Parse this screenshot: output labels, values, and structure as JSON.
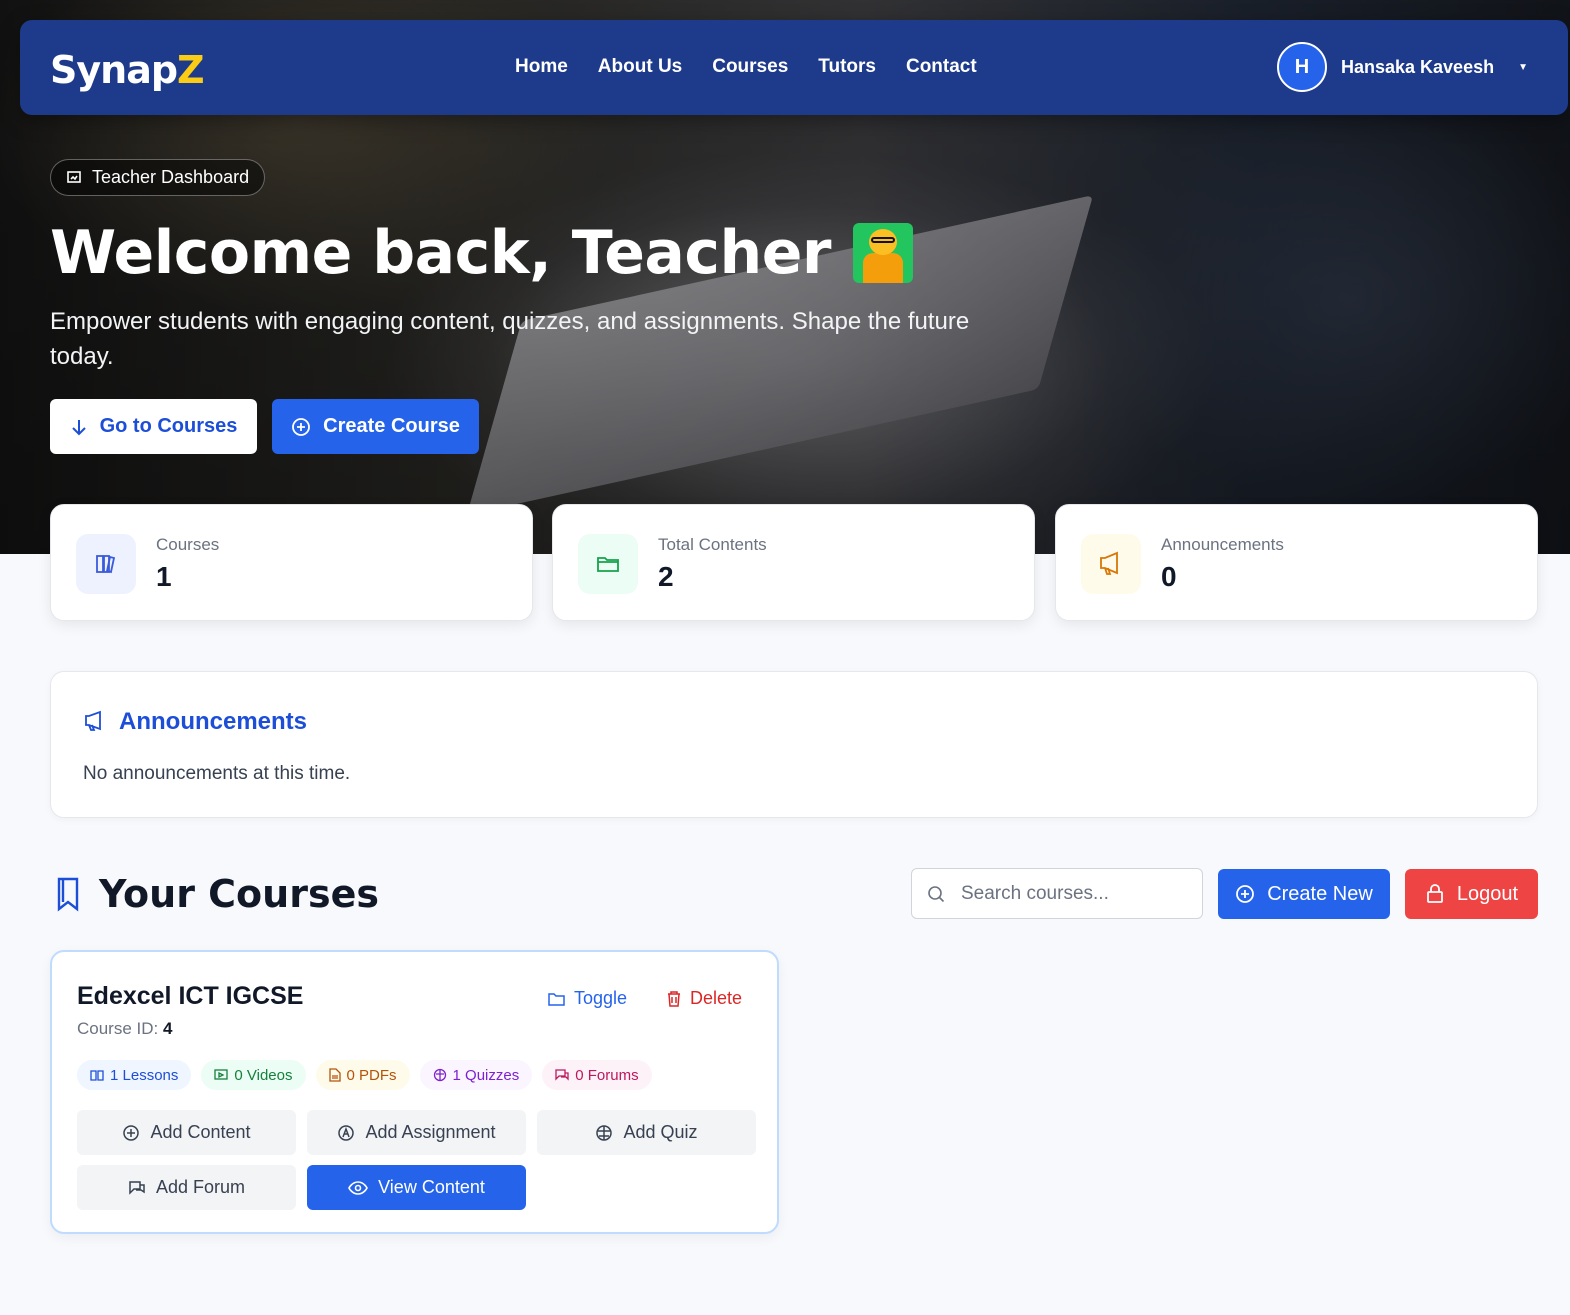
{
  "nav": {
    "logo_main": "Synap",
    "logo_accent": "Z",
    "links": [
      "Home",
      "About Us",
      "Courses",
      "Tutors",
      "Contact"
    ],
    "user_initial": "H",
    "user_name": "Hansaka Kaveesh"
  },
  "hero": {
    "badge": "Teacher Dashboard",
    "title": "Welcome back, Teacher",
    "subtitle": "Empower students with engaging content, quizzes, and assignments. Shape the future today.",
    "btn_courses": "Go to Courses",
    "btn_create": "Create Course"
  },
  "stats": [
    {
      "label": "Courses",
      "value": "1",
      "icon": "books-icon",
      "color": "#3b5bdb",
      "bg": "#eef2ff"
    },
    {
      "label": "Total Contents",
      "value": "2",
      "icon": "folder-icon",
      "color": "#16a34a",
      "bg": "#ecfdf5"
    },
    {
      "label": "Announcements",
      "value": "0",
      "icon": "megaphone-icon",
      "color": "#d97706",
      "bg": "#fffbeb"
    }
  ],
  "announcements": {
    "title": "Announcements",
    "empty": "No announcements at this time."
  },
  "courses": {
    "title": "Your Courses",
    "search_placeholder": "Search courses...",
    "create_new": "Create New",
    "logout": "Logout",
    "items": [
      {
        "name": "Edexcel ICT IGCSE",
        "id_label": "Course ID:",
        "id": "4",
        "toggle": "Toggle",
        "delete": "Delete",
        "chips": [
          {
            "text": "1 Lessons",
            "color": "#1d4ed8",
            "bg": "#eff6ff"
          },
          {
            "text": "0 Videos",
            "color": "#15803d",
            "bg": "#ecfdf5"
          },
          {
            "text": "0 PDFs",
            "color": "#b45309",
            "bg": "#fffbeb"
          },
          {
            "text": "1 Quizzes",
            "color": "#7e22ce",
            "bg": "#faf5ff"
          },
          {
            "text": "0 Forums",
            "color": "#be185d",
            "bg": "#fdf2f8"
          }
        ],
        "actions": [
          "Add Content",
          "Add Assignment",
          "Add Quiz",
          "Add Forum",
          "View Content"
        ]
      }
    ]
  }
}
